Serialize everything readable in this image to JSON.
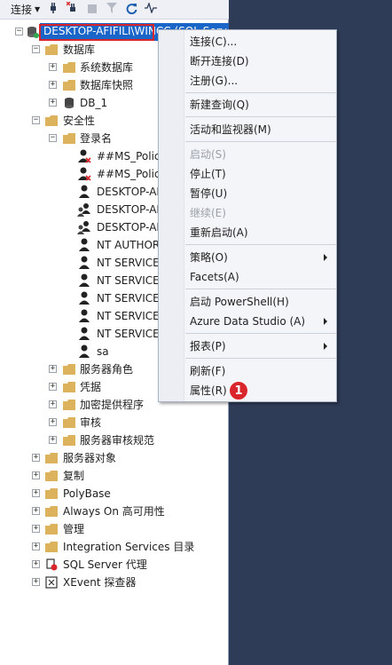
{
  "toolbar": {
    "connect_label": "连接"
  },
  "server": {
    "label": "DESKTOP-AFIFILI\\WINCC (SQL Server ...)"
  },
  "tree": {
    "databases": "数据库",
    "system_databases": "系统数据库",
    "db_snapshots": "数据库快照",
    "db1": "DB_1",
    "security": "安全性",
    "logins": "登录名",
    "login_items": [
      "##MS_PolicyEventProcessingLogin##",
      "##MS_PolicyTsqlExecutionLogin##",
      "DESKTOP-AFIFILI\\Administrator",
      "DESKTOP-AFIFILI\\SIMATIC HMI",
      "DESKTOP-AFIFILI\\SIMATIC HMI VIEWER",
      "NT AUTHORITY\\SYSTEM",
      "NT SERVICE\\SQLTELEMETRY$WINCC",
      "NT SERVICE\\SQLWriter",
      "NT SERVICE\\Winmgmt",
      "NT SERVICE\\MSSQL$WINCC",
      "NT SERVICE\\SQLAgent$WINCC",
      "sa"
    ],
    "server_roles": "服务器角色",
    "credentials": "凭据",
    "crypto_providers": "加密提供程序",
    "audits": "审核",
    "audit_specs": "服务器审核规范",
    "server_objects": "服务器对象",
    "replication": "复制",
    "polybase": "PolyBase",
    "always_on": "Always On 高可用性",
    "management": "管理",
    "integration_services": "Integration Services 目录",
    "sql_agent": "SQL Server 代理",
    "xevent": "XEvent 探查器"
  },
  "context_menu": {
    "connect": "连接(C)...",
    "disconnect": "断开连接(D)",
    "register": "注册(G)...",
    "new_query": "新建查询(Q)",
    "activity_monitor": "活动和监视器(M)",
    "start": "启动(S)",
    "stop": "停止(T)",
    "pause": "暂停(U)",
    "resume": "继续(E)",
    "restart": "重新启动(A)",
    "policies": "策略(O)",
    "facets": "Facets(A)",
    "powershell": "启动 PowerShell(H)",
    "azure_data_studio": "Azure Data Studio (A)",
    "reports": "报表(P)",
    "refresh": "刷新(F)",
    "properties": "属性(R)"
  },
  "annotation": {
    "badge_number": "1"
  },
  "colors": {
    "selection": "#1a66c8",
    "highlight_border": "#d9262c",
    "background": "#2f3c58"
  },
  "icons": [
    "plug-icon",
    "disconnect-icon",
    "stop-icon",
    "filter-icon",
    "refresh-icon",
    "activity-icon",
    "folder-icon",
    "database-icon",
    "user-icon",
    "group-icon",
    "agent-icon",
    "xevent-icon"
  ]
}
